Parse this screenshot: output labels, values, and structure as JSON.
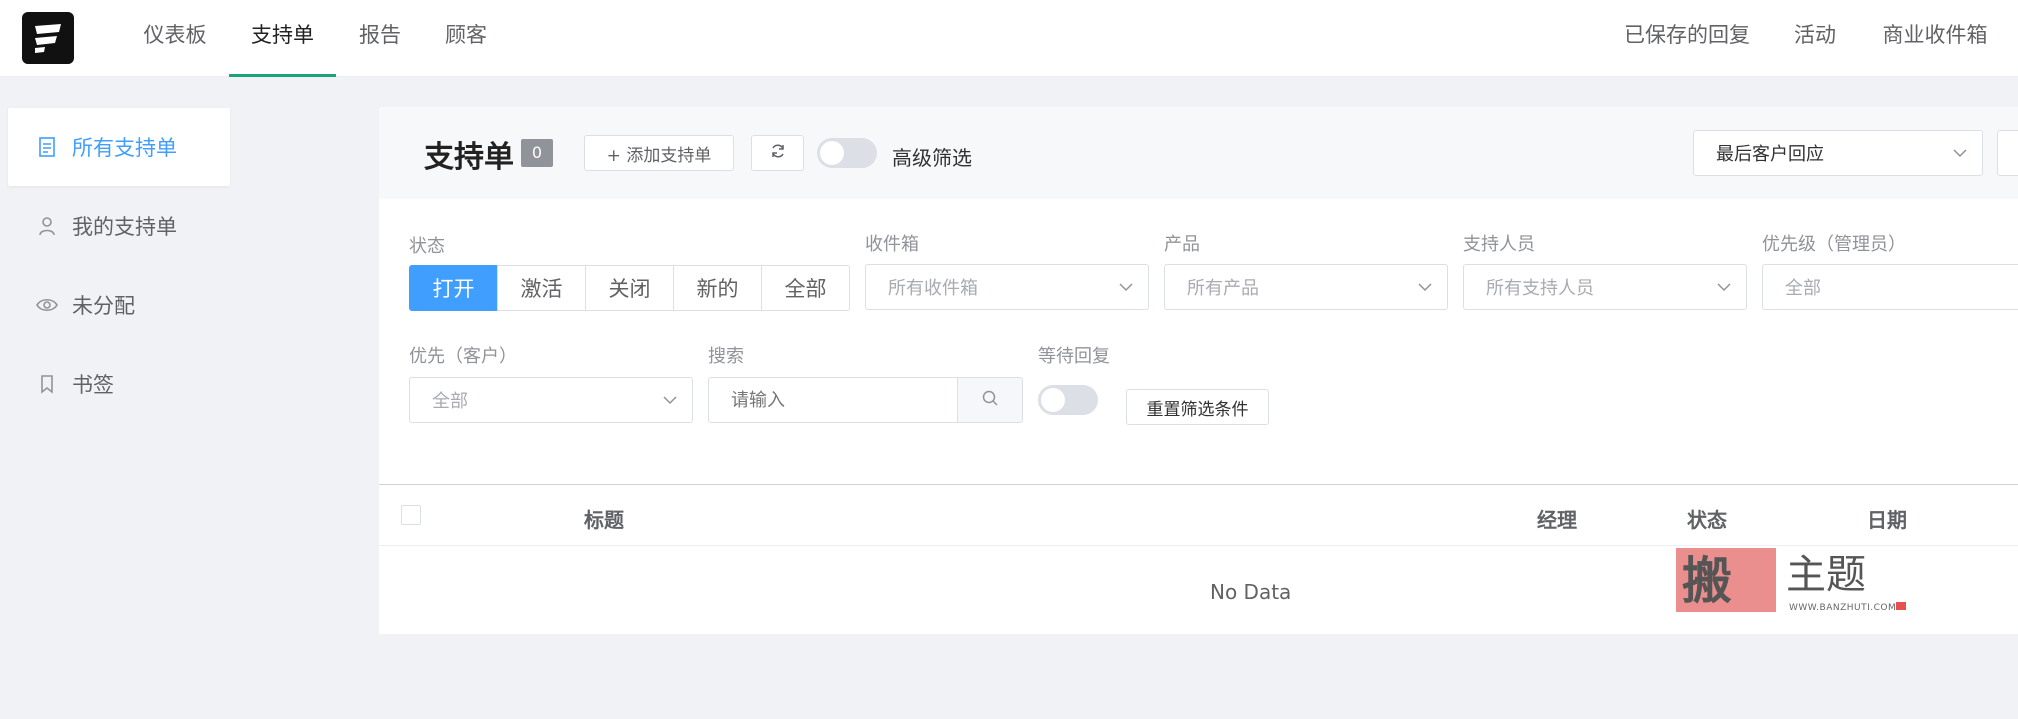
{
  "nav": {
    "left": [
      "仪表板",
      "支持单",
      "报告",
      "顾客"
    ],
    "right": [
      "已保存的回复",
      "活动",
      "商业收件箱"
    ]
  },
  "sidebar": {
    "items": [
      {
        "label": "所有支持单",
        "icon": "document-icon"
      },
      {
        "label": "我的支持单",
        "icon": "user-icon"
      },
      {
        "label": "未分配",
        "icon": "eye-icon"
      },
      {
        "label": "书签",
        "icon": "bookmark-icon"
      }
    ]
  },
  "header": {
    "title": "支持单",
    "count": "0",
    "add_label": "+ 添加支持单",
    "advanced_filter": "高级筛选",
    "sort_value": "最后客户回应"
  },
  "filters": {
    "status_label": "状态",
    "status_options": [
      "打开",
      "激活",
      "关闭",
      "新的",
      "全部"
    ],
    "inbox_label": "收件箱",
    "inbox_value": "所有收件箱",
    "product_label": "产品",
    "product_value": "所有产品",
    "agent_label": "支持人员",
    "agent_value": "所有支持人员",
    "priority_admin_label": "优先级（管理员）",
    "priority_admin_value": "全部",
    "priority_customer_label": "优先（客户）",
    "priority_customer_value": "全部",
    "search_label": "搜索",
    "search_placeholder": "请输入",
    "awaiting_label": "等待回复",
    "reset_label": "重置筛选条件"
  },
  "table": {
    "columns": [
      "标题",
      "经理",
      "状态",
      "日期"
    ],
    "empty": "No Data"
  },
  "watermark": {
    "text": "WWW.BANZHUTI.COM"
  },
  "colors": {
    "accent": "#409eff",
    "nav_active": "#1aa37a"
  }
}
